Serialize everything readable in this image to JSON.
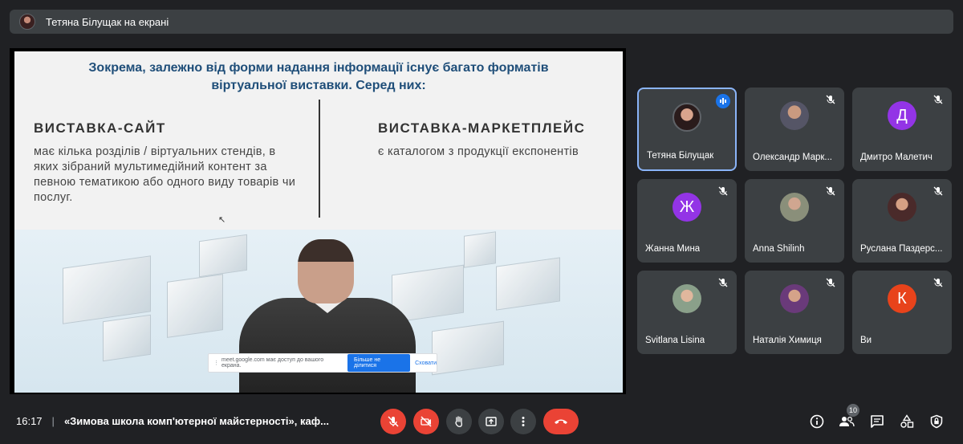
{
  "presenter_bar": {
    "label": "Тетяна Білущак на екрані"
  },
  "slide": {
    "title_line1": "Зокрема, залежно від форми надання інформації існує багато форматів",
    "title_line2": "віртуальної виставки. Серед них:",
    "left_heading": "ВИСТАВКА-САЙТ",
    "left_text": "має кілька розділів / віртуальних стендів, в яких зібраний мультимедійний контент за певною тематикою або одного виду товарів чи послуг.",
    "right_heading": "ВИСТАВКА-МАРКЕТПЛЕЙС",
    "right_text": "є каталогом з продукції експонентів"
  },
  "share_notice": {
    "text": "meet.google.com має доступ до вашого екрана.",
    "stop_label": "Більше не ділитися",
    "hide_label": "Сховати"
  },
  "participants": [
    {
      "name": "Тетяна Білущак",
      "initial": "",
      "color": "",
      "speaking": true
    },
    {
      "name": "Олександр Марк...",
      "initial": "",
      "color": "",
      "speaking": false
    },
    {
      "name": "Дмитро Малетич",
      "initial": "Д",
      "color": "#9334e6",
      "speaking": false
    },
    {
      "name": "Жанна Мина",
      "initial": "Ж",
      "color": "#9334e6",
      "speaking": false
    },
    {
      "name": "Anna Shilinh",
      "initial": "",
      "color": "",
      "speaking": false
    },
    {
      "name": "Руслана Паздерс...",
      "initial": "",
      "color": "",
      "speaking": false
    },
    {
      "name": "Svitlana Lisina",
      "initial": "",
      "color": "",
      "speaking": false
    },
    {
      "name": "Наталія Химиця",
      "initial": "",
      "color": "",
      "speaking": false
    },
    {
      "name": "Ви",
      "initial": "К",
      "color": "#e8431b",
      "speaking": false
    }
  ],
  "bottom_bar": {
    "time": "16:17",
    "separator": "|",
    "meeting_title": "«Зимова школа комп'ютерної майстерності», каф...",
    "participant_count": "10"
  },
  "colors": {
    "background": "#202124",
    "tile": "#3c4043",
    "danger": "#ea4335",
    "accent": "#1a73e8",
    "active_border": "#8ab4f8"
  }
}
